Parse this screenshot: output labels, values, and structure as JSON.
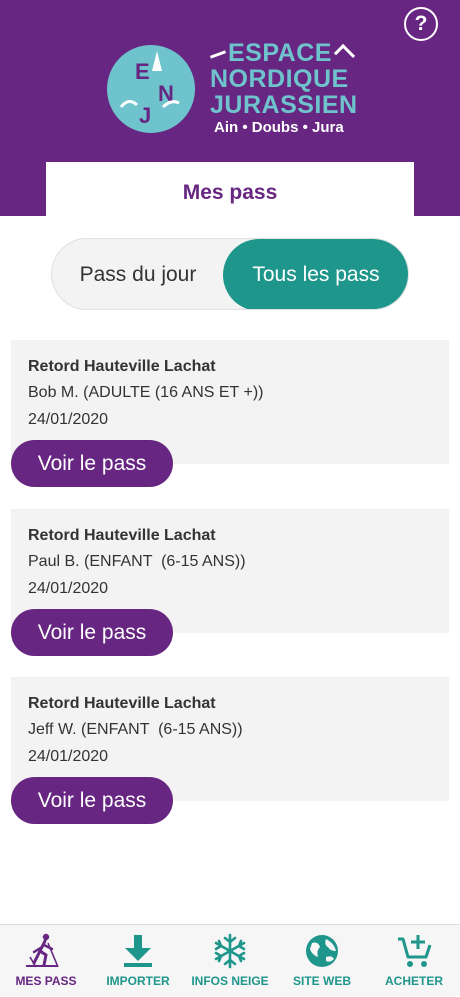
{
  "header": {
    "help_label": "?",
    "logo": {
      "circle_letters": [
        "E",
        "N",
        "J"
      ],
      "line1": "ESPACE",
      "line2": "NORDIQUE",
      "line3": "JURASSIEN",
      "subtitle": "Ain • Doubs • Jura"
    },
    "page_title": "Mes pass"
  },
  "toggle": {
    "left_label": "Pass du jour",
    "right_label": "Tous les pass",
    "selected": "Tous les pass"
  },
  "passes": [
    {
      "station": "Retord Hauteville Lachat",
      "holder": "Bob M. (ADULTE (16 ANS ET +))",
      "date": "24/01/2020",
      "button": "Voir le pass"
    },
    {
      "station": "Retord Hauteville Lachat",
      "holder": "Paul B. (ENFANT  (6-15 ANS))",
      "date": "24/01/2020",
      "button": "Voir le pass"
    },
    {
      "station": "Retord Hauteville Lachat",
      "holder": "Jeff W. (ENFANT  (6-15 ANS))",
      "date": "24/01/2020",
      "button": "Voir le pass"
    }
  ],
  "tabbar": [
    {
      "label": "MES PASS",
      "icon": "skier-icon",
      "active": true
    },
    {
      "label": "IMPORTER",
      "icon": "download-icon",
      "active": false
    },
    {
      "label": "INFOS NEIGE",
      "icon": "snowflake-icon",
      "active": false
    },
    {
      "label": "SITE WEB",
      "icon": "globe-icon",
      "active": false
    },
    {
      "label": "ACHETER",
      "icon": "cart-add-icon",
      "active": false
    }
  ],
  "colors": {
    "brand_purple": "#672681",
    "accent_teal": "#1f968c",
    "logo_cyan": "#6fc3cd"
  }
}
